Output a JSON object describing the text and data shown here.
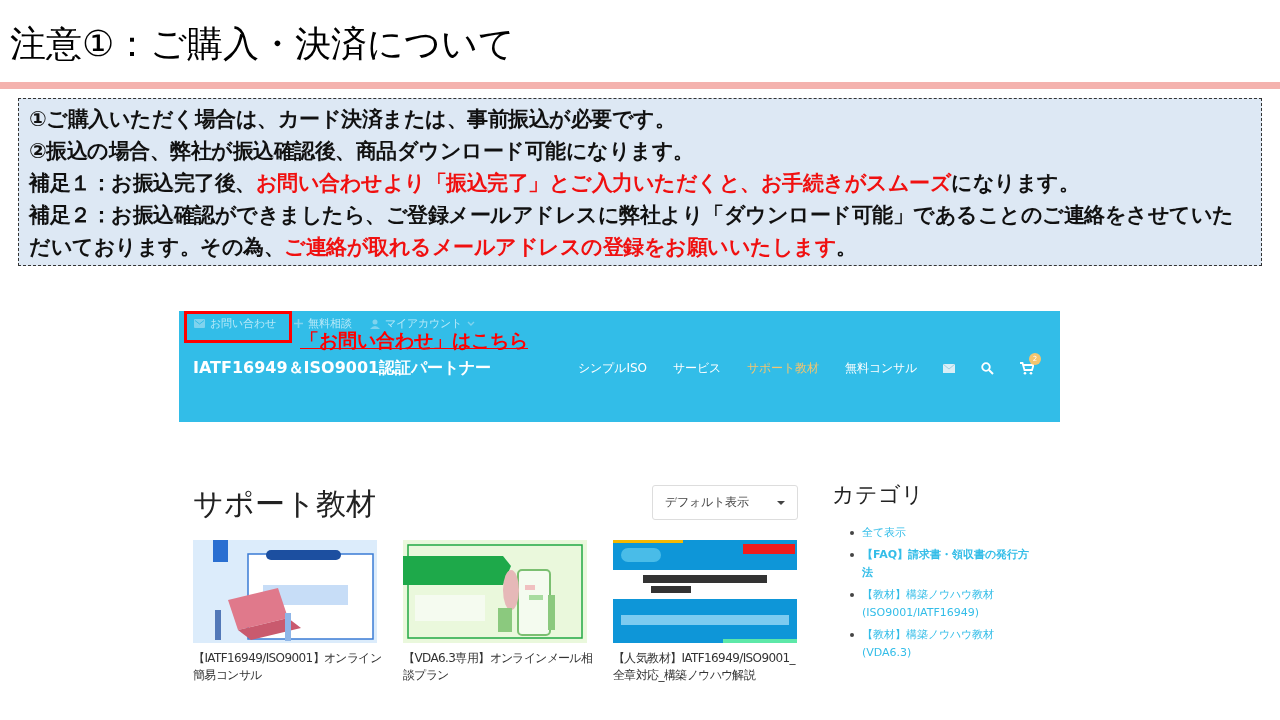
{
  "slide": {
    "title": "注意①：ご購入・決済について",
    "notes": [
      {
        "segments": [
          {
            "text": "①ご購入いただく場合は、カード決済または、事前振込が必要です。",
            "emphasis": false
          }
        ]
      },
      {
        "segments": [
          {
            "text": "②振込の場合、弊社が振込確認後、商品ダウンロード可能になります。",
            "emphasis": false
          }
        ]
      },
      {
        "segments": [
          {
            "text": "補足１：お振込完了後、",
            "emphasis": false
          },
          {
            "text": "お問い合わせより「振込完了」とご入力いただくと、お手続きがスムーズ",
            "emphasis": true
          },
          {
            "text": "になります。",
            "emphasis": false
          }
        ]
      },
      {
        "segments": [
          {
            "text": "補足２：お振込確認ができましたら、ご登録メールアドレスに弊社より「ダウンロード可能」であることのご連絡をさせていただいております。その為、",
            "emphasis": false
          },
          {
            "text": "ご連絡が取れるメールアドレスの登録をお願いいたします",
            "emphasis": true
          },
          {
            "text": "。",
            "emphasis": false
          }
        ]
      }
    ]
  },
  "screenshot": {
    "top_links": [
      {
        "kind": "mail",
        "label": "お問い合わせ"
      },
      {
        "kind": "plus",
        "label": "無料相談"
      },
      {
        "kind": "account",
        "label": "マイアカウント"
      }
    ],
    "site_title": "IATF16949＆ISO9001認証パートナー",
    "nav": [
      {
        "label": "シンプルISO",
        "selected": false
      },
      {
        "label": "サービス",
        "selected": false
      },
      {
        "label": "サポート教材",
        "selected": true
      },
      {
        "label": "無料コンサル",
        "selected": false
      }
    ],
    "cart_count": "2",
    "heading": "サポート教材",
    "sort": {
      "value": "デフォルト表示"
    },
    "products": [
      {
        "kind": "picture",
        "title": "【IATF16949/ISO9001】オンライン簡易コンサル"
      },
      {
        "kind": "picture",
        "title": "【VDA6.3専用】オンラインメール相談プラン"
      },
      {
        "kind": "picture",
        "title": "【人気教材】IATF16949/ISO9001_全章対応_構築ノウハウ解説"
      }
    ],
    "sidebar": {
      "title": "カテゴリ",
      "items": [
        {
          "label": "全て表示",
          "selected": false
        },
        {
          "label": "【FAQ】請求書・領収書の発行方法",
          "selected": true
        },
        {
          "label": "【教材】構築ノウハウ教材(ISO9001/IATF16949)",
          "selected": false
        },
        {
          "label": "【教材】構築ノウハウ教材(VDA6.3)",
          "selected": false
        }
      ]
    }
  },
  "annotation": {
    "label": "「お問い合わせ」はこちら"
  }
}
